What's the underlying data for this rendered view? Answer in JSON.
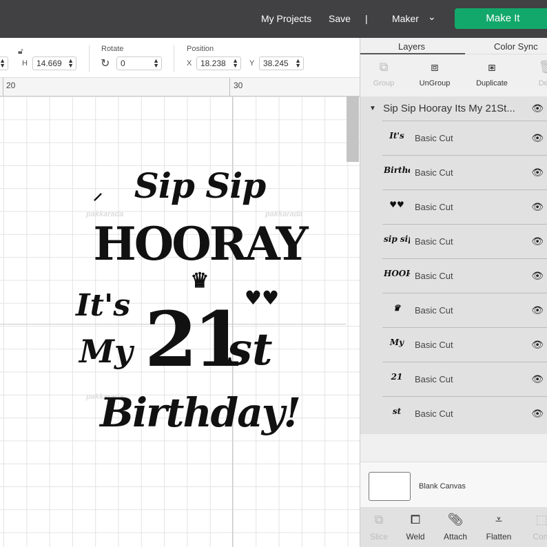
{
  "topbar": {
    "my_projects": "My Projects",
    "save": "Save",
    "divider": "|",
    "machine": "Maker",
    "make_it": "Make It"
  },
  "toolbar": {
    "h_label": "H",
    "h_value": "14.669",
    "rotate_label": "Rotate",
    "rotate_value": "0",
    "position_label": "Position",
    "x_label": "X",
    "x_value": "18.238",
    "y_label": "Y",
    "y_value": "38.245"
  },
  "ruler": {
    "ticks": [
      "20",
      "30"
    ]
  },
  "artwork": {
    "line1": "Sip Sip",
    "line2": "HOORAY",
    "line3": "It's",
    "line4a": "My",
    "line4b": "21",
    "line4c": "st",
    "line5": "Birthday!",
    "watermark": "pakkarada"
  },
  "panel": {
    "tabs": [
      "Layers",
      "Color Sync"
    ],
    "actions": [
      "Group",
      "UnGroup",
      "Duplicate",
      "Dele"
    ],
    "group_name": "Sip Sip Hooray Its My 21St...",
    "layers": [
      {
        "thumb": "It's",
        "label": "Basic Cut"
      },
      {
        "thumb": "Birthday",
        "label": "Basic Cut"
      },
      {
        "thumb": "♥♥",
        "label": "Basic Cut"
      },
      {
        "thumb": "sip sip",
        "label": "Basic Cut"
      },
      {
        "thumb": "HOORAY",
        "label": "Basic Cut"
      },
      {
        "thumb": "♛",
        "label": "Basic Cut"
      },
      {
        "thumb": "My",
        "label": "Basic Cut"
      },
      {
        "thumb": "21",
        "label": "Basic Cut"
      },
      {
        "thumb": "st",
        "label": "Basic Cut"
      }
    ],
    "blank_canvas": "Blank Canvas",
    "bottom_actions": [
      "Slice",
      "Weld",
      "Attach",
      "Flatten",
      "Cont"
    ]
  }
}
